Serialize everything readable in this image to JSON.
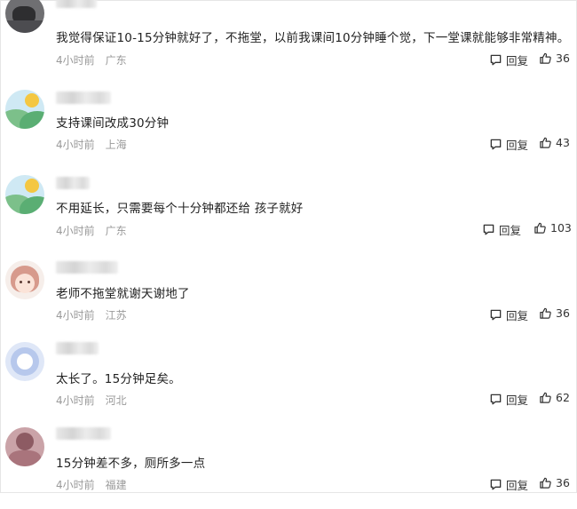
{
  "comments": [
    {
      "text": "我觉得保证10-15分钟就好了，不拖堂，以前我课间10分钟睡个觉，下一堂课就能够非常精神。",
      "time": "4小时前",
      "location": "广东",
      "reply_label": "回复",
      "likes": "36",
      "avatar": "photo-avatar"
    },
    {
      "text": "支持课间改成30分钟",
      "time": "4小时前",
      "location": "上海",
      "reply_label": "回复",
      "likes": "43",
      "avatar": "landscape-default-avatar"
    },
    {
      "text": "不用延长，只需要每个十分钟都还给 孩子就好",
      "time": "4小时前",
      "location": "广东",
      "reply_label": "回复",
      "likes": "103",
      "avatar": "landscape-default-avatar"
    },
    {
      "text": "老师不拖堂就谢天谢地了",
      "time": "4小时前",
      "location": "江苏",
      "reply_label": "回复",
      "likes": "36",
      "avatar": "cartoon-girl-avatar"
    },
    {
      "text": "太长了。15分钟足矣。",
      "time": "4小时前",
      "location": "河北",
      "reply_label": "回复",
      "likes": "62",
      "avatar": "default-user-avatar"
    },
    {
      "text": "15分钟差不多，厕所多一点",
      "time": "4小时前",
      "location": "福建",
      "reply_label": "回复",
      "likes": "36",
      "avatar": "photo-avatar"
    }
  ],
  "colors": {
    "text": "#222222",
    "meta": "#9a9a9a",
    "background": "#ffffff"
  }
}
